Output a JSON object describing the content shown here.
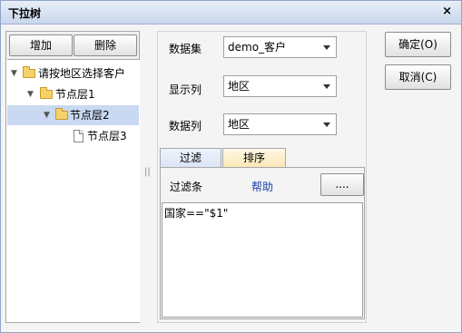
{
  "dialog": {
    "title": "下拉树",
    "close_glyph": "×"
  },
  "left": {
    "add_label": "增加",
    "delete_label": "删除",
    "tree": [
      {
        "label": "请按地区选择客户",
        "type": "folder",
        "expanded": true,
        "selected": false
      },
      {
        "label": "节点层1",
        "type": "folder",
        "expanded": true,
        "selected": false
      },
      {
        "label": "节点层2",
        "type": "folder",
        "expanded": true,
        "selected": true
      },
      {
        "label": "节点层3",
        "type": "file",
        "expanded": false,
        "selected": false
      }
    ],
    "expanded_glyph": "▼",
    "splitter_glyph": "||"
  },
  "form": {
    "dataset_label": "数据集",
    "dataset_value": "demo_客户",
    "display_label": "显示列",
    "display_value": "地区",
    "data_label": "数据列",
    "data_value": "地区"
  },
  "tabs": {
    "filter_label": "过滤",
    "sort_label": "排序",
    "active": "sort"
  },
  "filter": {
    "condition_label": "过滤条",
    "help_label": "帮助",
    "more_button_label": "....",
    "expression": "国家==\"$1\""
  },
  "actions": {
    "ok_label": "确定(O)",
    "cancel_label": "取消(C)"
  },
  "colors": {
    "selected_node": "#c9d9f2",
    "help_link": "#1a3fa8",
    "active_tab": "#fbe7b5"
  }
}
